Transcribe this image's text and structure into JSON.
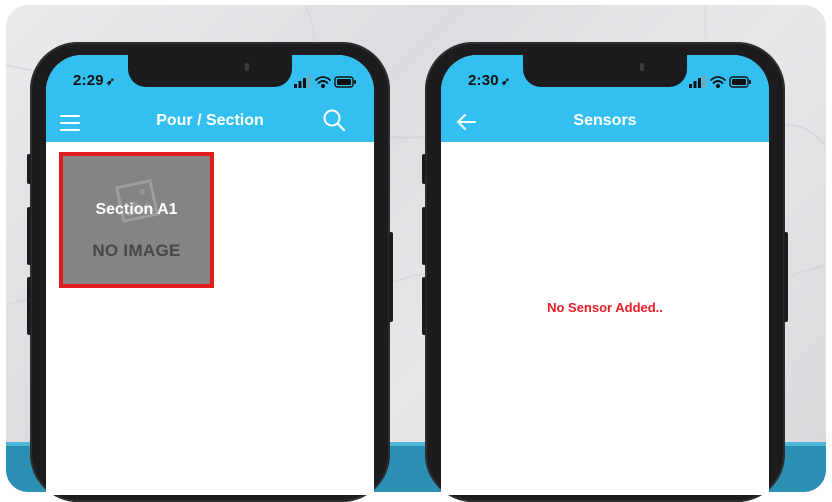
{
  "left_phone": {
    "status_time": "2:29",
    "title": "Pour / Section",
    "tile": {
      "label": "Section A1",
      "placeholder": "NO IMAGE"
    }
  },
  "right_phone": {
    "status_time": "2:30",
    "title": "Sensors",
    "empty_message": "No Sensor Added.."
  },
  "colors": {
    "app_bar": "#33c0f0",
    "highlight_border": "#e11b1b",
    "empty_message": "#ec1c24",
    "bottom_band": "#2b8fb3"
  },
  "icons": [
    "location-arrow-icon",
    "signal-icon",
    "wifi-icon",
    "battery-icon",
    "menu-icon",
    "search-icon",
    "back-arrow-icon",
    "image-placeholder-icon"
  ]
}
